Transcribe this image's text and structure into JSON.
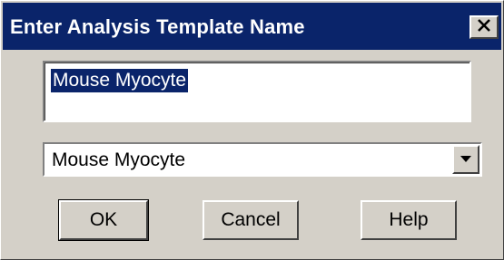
{
  "window": {
    "title": "Enter Analysis Template Name",
    "close_icon": "close-icon"
  },
  "name_input": {
    "value": "Mouse Myocyte",
    "selected": true
  },
  "template_select": {
    "selected": "Mouse Myocyte",
    "arrow_icon": "dropdown-arrow-icon"
  },
  "buttons": {
    "ok": "OK",
    "cancel": "Cancel",
    "help": "Help"
  },
  "colors": {
    "titlebar": "#0a246a",
    "face": "#d4d0c8",
    "selection": "#0a246a"
  }
}
